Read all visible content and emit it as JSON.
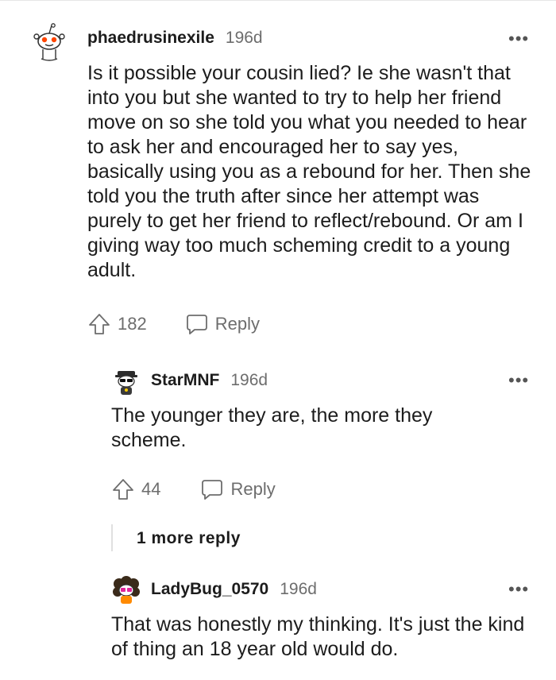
{
  "comments": [
    {
      "username": "phaedrusinexile",
      "age": "196d",
      "body": "Is it possible your cousin lied? Ie she wasn't that into you but she wanted to try to help her friend move on so she told you what you needed to hear to ask her and encouraged her to say yes, basically using you as a rebound for her. Then she told you the truth after since her attempt was purely to get her friend to reflect/rebound. Or am I giving way too much scheming credit to a young adult.",
      "votes": "182",
      "reply_label": "Reply",
      "more_label": "•••"
    },
    {
      "username": "StarMNF",
      "age": "196d",
      "body": "The younger they are, the more they scheme.",
      "votes": "44",
      "reply_label": "Reply",
      "more_label": "•••"
    },
    {
      "username": "LadyBug_0570",
      "age": "196d",
      "body": "That was honestly my thinking. It's just the kind of thing an 18 year old would do.",
      "more_label": "•••"
    }
  ],
  "more_replies_label": "1 more reply",
  "colors": {
    "text": "#1c1c1c",
    "meta": "#6d6d6d",
    "thread_line": "#e0e0e0",
    "snoo_red": "#ff4500"
  }
}
